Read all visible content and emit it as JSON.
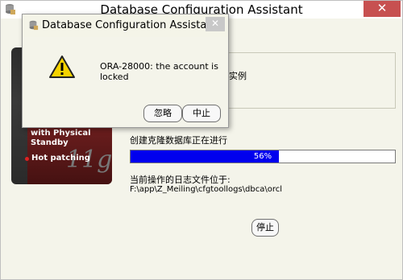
{
  "main_window": {
    "title": "Database Configuration Assistant",
    "close_glyph": "✕",
    "info_text": "实例",
    "progress_label": "创建克隆数据库正在进行",
    "progress": {
      "value_percent": 56,
      "text": "56%"
    },
    "log_label": "当前操作的日志文件位于:",
    "log_path": "F:\\app\\Z_Meiling\\cfgtoollogs\\dbca\\orcl",
    "stop_button": "停止",
    "banner": {
      "line1": "with Physical",
      "line2": "Standby",
      "bullet_text": "Hot patching",
      "logo_text": "11g"
    }
  },
  "dialog": {
    "title": "Database Configuration Assistant",
    "close_glyph": "✕",
    "message": "ORA-28000: the account is locked",
    "buttons": {
      "ignore": "忽略",
      "abort": "中止"
    },
    "icon": "warning-icon"
  },
  "colors": {
    "progress_fill": "#0000ee",
    "window_bg": "#f4f4ea",
    "close_button": "#c75050"
  }
}
